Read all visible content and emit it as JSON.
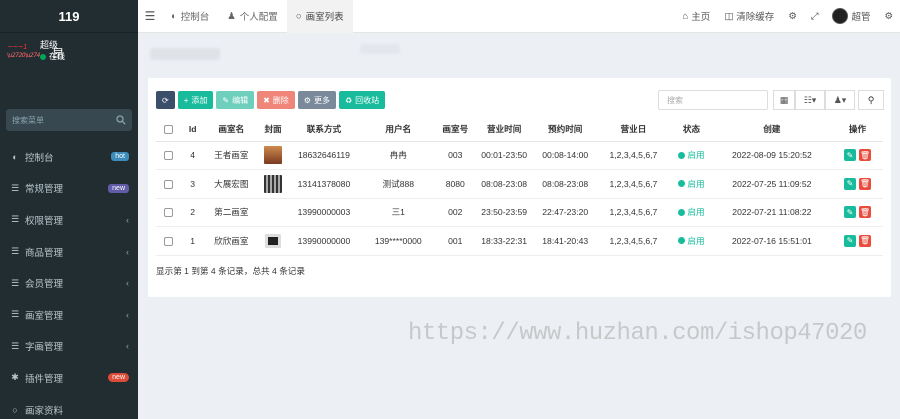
{
  "brand": "119",
  "user": {
    "logo_text": "优化图片",
    "name": "超级",
    "status": "在线",
    "extra": "昂"
  },
  "sidebar": {
    "search_placeholder": "搜索菜单",
    "items": [
      {
        "label": "控制台",
        "icon": "dashboard-icon",
        "badge": "hot",
        "chevron": ""
      },
      {
        "label": "常规管理",
        "icon": "list-icon",
        "badge": "new",
        "chevron": ""
      },
      {
        "label": "权限管理",
        "icon": "list-icon",
        "badge": "",
        "chevron": "‹"
      },
      {
        "label": "商品管理",
        "icon": "list-icon",
        "badge": "",
        "chevron": "‹"
      },
      {
        "label": "会员管理",
        "icon": "list-icon",
        "badge": "",
        "chevron": "‹"
      },
      {
        "label": "画室管理",
        "icon": "list-icon",
        "badge": "",
        "chevron": "‹"
      },
      {
        "label": "字画管理",
        "icon": "list-icon",
        "badge": "",
        "chevron": "‹"
      },
      {
        "label": "插件管理",
        "icon": "puzzle-icon",
        "badge": "new",
        "chevron": ""
      },
      {
        "label": "画家资料",
        "icon": "circle-icon",
        "badge": "",
        "chevron": ""
      }
    ]
  },
  "topbar": {
    "tabs": [
      {
        "label": "控制台",
        "icon": "dashboard-icon"
      },
      {
        "label": "个人配置",
        "icon": "user-icon"
      },
      {
        "label": "画室列表",
        "icon": "circle-icon"
      }
    ],
    "home": "主页",
    "clear_cache": "清除缓存",
    "admin": "超管"
  },
  "toolbar": {
    "add": "添加",
    "edit": "编辑",
    "delete": "删除",
    "more": "更多",
    "recycle": "回收站",
    "search_placeholder": "搜索"
  },
  "table": {
    "headers": [
      "Id",
      "画室名",
      "封面",
      "联系方式",
      "用户名",
      "画室号",
      "营业时间",
      "预约时间",
      "营业日",
      "状态",
      "创建",
      "操作"
    ],
    "rows": [
      {
        "id": "4",
        "name": "王者画室",
        "cover": "cover-painting",
        "phone": "18632646119",
        "user": "冉冉",
        "no": "003",
        "hours": "00:01-23:50",
        "booking": "00:08-14:00",
        "days": "1,2,3,4,5,6,7",
        "status": "启用",
        "created": "2022-08-09 15:20:52"
      },
      {
        "id": "3",
        "name": "大展宏图",
        "cover": "cover-piano",
        "phone": "13141378080",
        "user": "测试888",
        "no": "8080",
        "hours": "08:08-23:08",
        "booking": "08:08-23:08",
        "days": "1,2,3,4,5,6,7",
        "status": "启用",
        "created": "2022-07-25 11:09:52"
      },
      {
        "id": "2",
        "name": "第二画室",
        "cover": "cover-empty",
        "phone": "13990000003",
        "user": "三1",
        "no": "002",
        "hours": "23:50-23:59",
        "booking": "22:47-23:20",
        "days": "1,2,3,4,5,6,7",
        "status": "启用",
        "created": "2022-07-21 11:08:22"
      },
      {
        "id": "1",
        "name": "欣欣画室",
        "cover": "cover-frame",
        "phone": "13990000000",
        "user": "139****0000",
        "no": "001",
        "hours": "18:33-22:31",
        "booking": "18:41-20:43",
        "days": "1,2,3,4,5,6,7",
        "status": "启用",
        "created": "2022-07-16 15:51:01"
      }
    ]
  },
  "page_info": "显示第 1 到第 4 条记录，总共 4 条记录",
  "watermark": "https://www.huzhan.com/ishop47020",
  "colors": {
    "sidebar": "#222d32",
    "accent_green": "#18bc9c",
    "delete_red": "#e74c3c",
    "toolbar_dark": "#3c4f6a"
  }
}
